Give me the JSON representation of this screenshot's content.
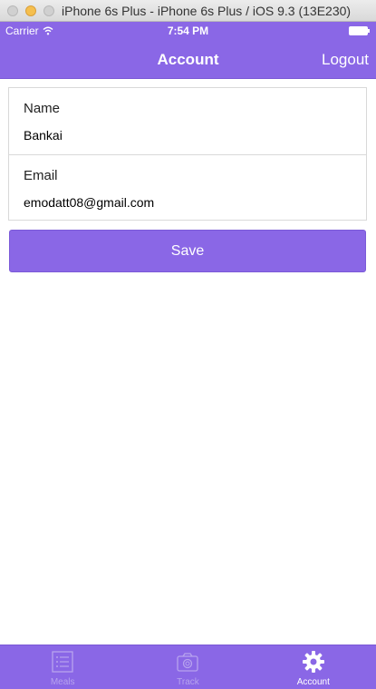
{
  "window": {
    "title": "iPhone 6s Plus - iPhone 6s Plus / iOS 9.3 (13E230)"
  },
  "status_bar": {
    "carrier": "Carrier",
    "time": "7:54 PM"
  },
  "nav": {
    "title": "Account",
    "logout_label": "Logout"
  },
  "form": {
    "name_label": "Name",
    "name_value": "Bankai",
    "email_label": "Email",
    "email_value": "emodatt08@gmail.com"
  },
  "save_label": "Save",
  "tabs": [
    {
      "label": "Meals",
      "icon": "list-icon",
      "active": false
    },
    {
      "label": "Track",
      "icon": "camera-icon",
      "active": false
    },
    {
      "label": "Account",
      "icon": "gear-icon",
      "active": true
    }
  ],
  "colors": {
    "accent": "#8a67e6"
  }
}
